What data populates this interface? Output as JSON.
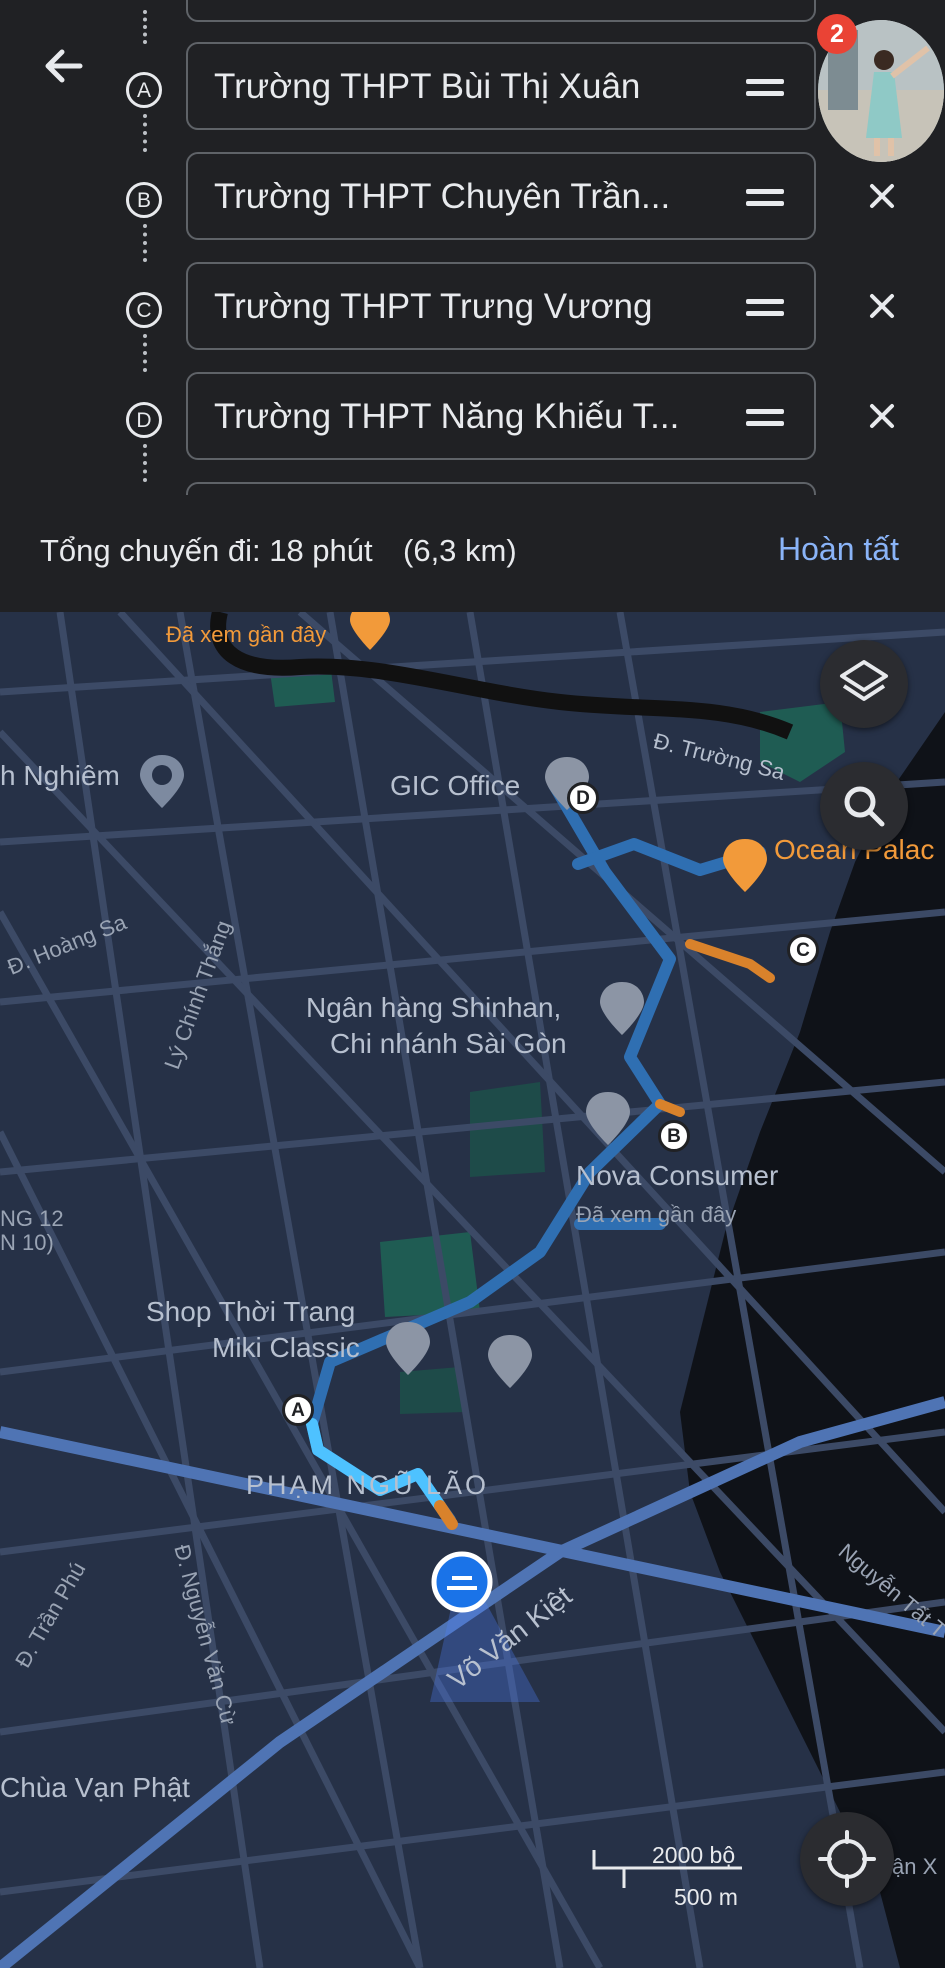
{
  "directions": {
    "waypoints": [
      {
        "marker": "A",
        "name": "Trường THPT Bùi Thị Xuân"
      },
      {
        "marker": "B",
        "name": "Trường THPT Chuyên Trần..."
      },
      {
        "marker": "C",
        "name": "Trường THPT Trưng Vương"
      },
      {
        "marker": "D",
        "name": "Trường THPT Năng Khiếu T..."
      }
    ],
    "notification_count": "2"
  },
  "summary": {
    "label": "Tổng chuyến đi: 18 phút",
    "distance": "(6,3 km)",
    "done_label": "Hoàn tất"
  },
  "map": {
    "labels": {
      "recently_viewed_top": "Đã xem gần đây",
      "truong_sa": "Đ. Trường Sa",
      "nghiem": "h Nghiêm",
      "gic_office": "GIC Office",
      "ocean_palace": "Ocean Palac",
      "hoang_sa": "Đ. Hoàng Sa",
      "ly_chinh_thang": "Lý Chính Thắng",
      "shinhan_1": "Ngân hàng Shinhan,",
      "shinhan_2": "Chi nhánh Sài Gòn",
      "nova_consumer": "Nova Consumer",
      "recently_viewed_nova": "Đã xem gần đây",
      "ng12_1": "NG 12",
      "ng12_2": "N 10)",
      "miki_1": "Shop Thời Trang",
      "miki_2": "Miki Classic",
      "pham_ngu_lao": "PHẠM NGŨ LÃO",
      "tran_phu": "Đ. Trần Phú",
      "nguyen_van_cu": "Đ. Nguyễn Văn Cừ",
      "vo_van_kiet": "Võ Văn Kiệt",
      "nguyen_tat_thanh": "Nguyễn Tất T",
      "chua_van_phat": "Chùa Vạn Phật",
      "van_x": "ận X"
    },
    "route_stops": [
      "A",
      "B",
      "C",
      "D"
    ],
    "scale": {
      "top": "2000 bộ",
      "bottom": "500 m"
    },
    "colors": {
      "route_main": "#1a73e8",
      "route_past": "#2f6fb2",
      "route_slow": "#d9822b",
      "water": "#0f1218",
      "park": "#1f5c53",
      "road": "#4a5a78",
      "major_road": "#4f74b4"
    }
  }
}
